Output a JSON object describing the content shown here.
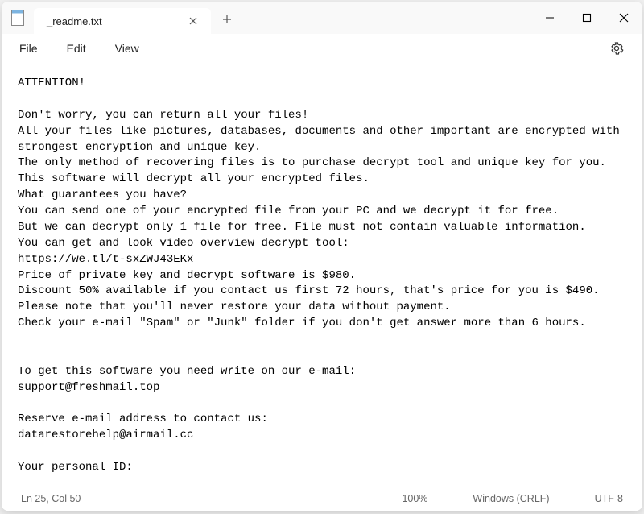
{
  "window": {
    "tab_title": "_readme.txt"
  },
  "menu": {
    "file": "File",
    "edit": "Edit",
    "view": "View"
  },
  "content": {
    "line1": "ATTENTION!",
    "line2": "Don't worry, you can return all your files!",
    "line3": "All your files like pictures, databases, documents and other important are encrypted with strongest encryption and unique key.",
    "line4": "The only method of recovering files is to purchase decrypt tool and unique key for you.",
    "line5": "This software will decrypt all your encrypted files.",
    "line6": "What guarantees you have?",
    "line7": "You can send one of your encrypted file from your PC and we decrypt it for free.",
    "line8": "But we can decrypt only 1 file for free. File must not contain valuable information.",
    "line9": "You can get and look video overview decrypt tool:",
    "line10": "https://we.tl/t-sxZWJ43EKx",
    "line11": "Price of private key and decrypt software is $980.",
    "line12": "Discount 50% available if you contact us first 72 hours, that's price for you is $490.",
    "line13": "Please note that you'll never restore your data without payment.",
    "line14": "Check your e-mail \"Spam\" or \"Junk\" folder if you don't get answer more than 6 hours.",
    "line15": "To get this software you need write on our e-mail:",
    "line16": "support@freshmail.top",
    "line17": "Reserve e-mail address to contact us:",
    "line18": "datarestorehelp@airmail.cc",
    "line19": "Your personal ID:"
  },
  "status": {
    "position": "Ln 25, Col 50",
    "zoom": "100%",
    "line_ending": "Windows (CRLF)",
    "encoding": "UTF-8"
  }
}
